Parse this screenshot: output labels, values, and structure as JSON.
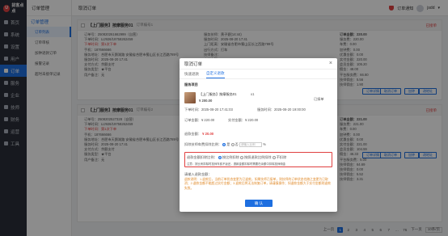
{
  "app": {
    "logo_mark": "U",
    "name": "拢客点点",
    "page_title": "订单管理",
    "breadcrumb": "取消订单",
    "notice_label": "订单通知",
    "user_name": "jsdd",
    "user_caret": "▾"
  },
  "nav": [
    {
      "label": "首页",
      "icon": "home-icon"
    },
    {
      "label": "系统",
      "icon": "system-icon"
    },
    {
      "label": "设置",
      "icon": "settings-icon"
    },
    {
      "label": "用户",
      "icon": "user-icon"
    },
    {
      "label": "订单",
      "icon": "order-icon",
      "active": true
    },
    {
      "label": "服务",
      "icon": "service-icon"
    },
    {
      "label": "企业",
      "icon": "enterprise-icon"
    },
    {
      "label": "技师",
      "icon": "technician-icon"
    },
    {
      "label": "财务",
      "icon": "finance-icon"
    },
    {
      "label": "运营",
      "icon": "operations-icon"
    },
    {
      "label": "工具",
      "icon": "tools-icon"
    }
  ],
  "subnav": {
    "group": "订单管理",
    "items": [
      "订单列表",
      "订单审核",
      "加钟退款订单",
      "报警记录",
      "超时未接单记录"
    ]
  },
  "orders": [
    {
      "shop": "【上门服务】按摩服务01",
      "order_no": "订单编号1",
      "status": "已接单",
      "lines": [
        "订单号：250820261662999（自营）",
        "下单时间：LIJ926/19758262459",
        "下单时间：第1次下单",
        "手机：187666666",
        "服务地址：合肥市天鹅湖路 安徽省合肥市蜀山区长江西路789号",
        "服务时间：2025-08-20 17:41",
        "支付方式：余额支付",
        "服务类型：★平台",
        "用户备注：无"
      ],
      "mid": [
        "服务技师：黄子碧(14:44)",
        "服务时间：2025-08-20 17:41",
        "上门距离：安徽省合肥市蜀山区长江西路789号",
        "出行方式：打车",
        "技师备注：",
        "实付金额："
      ],
      "amounts": [
        "订单金额：220.00",
        "服务费：220.00",
        "车费：0.00",
        "加钟费：0.00",
        "优惠金额：0.00",
        "实付金额：220.00",
        "会员金额：105.20",
        "佣金：48.00",
        "平台服务费：66.80",
        "技师佣金：5.56",
        "技师佣金：1.90"
      ],
      "buttons": [
        "订单详情",
        "取消订单",
        "加钟",
        "改地址"
      ]
    },
    {
      "shop": "【上门服务】按摩服务01",
      "order_no": "订单编号2",
      "status": "已接单",
      "lines": [
        "订单号：25082025273​28（自营）",
        "下单时间：LIJ926/19758262459",
        "下单时间：第1次下单",
        "手机：187666666",
        "服务地址：合肥市天鹅湖路 安徽省合肥市蜀山区长江西路789号",
        "服务时间：2025-08-20 17:41",
        "支付方式：余额支付",
        "服务类型：★平台",
        "用户备注：无"
      ],
      "mid": [
        "服务技师：黄子碧(14:44)",
        "服务时间：2025-08-20 17:41",
        "上门距离：安徽省合肥市蜀山区长江西路789号",
        "出行方式：打车",
        "技师备注：",
        "实付金额："
      ],
      "amounts": [
        "订单金额：221.00",
        "服务费：221.00",
        "车费：0.00",
        "加钟费：0.00",
        "优惠金额：0.00",
        "实付金额：221.00",
        "会员金额：104.59",
        "佣金：46.33",
        "平台服务费：5.00",
        "技师佣金：64.69",
        "技师佣金：0.00",
        "技师佣金：5.52",
        "技师佣金：3.31"
      ],
      "buttons": [
        "订单详情",
        "取消订单",
        "加钟",
        "改地址"
      ]
    }
  ],
  "pager": {
    "prev": "上一页",
    "pages": [
      "1",
      "2",
      "3",
      "4",
      "5",
      "6",
      "7",
      "…",
      "76"
    ],
    "active": "1",
    "next": "下一页",
    "page_size": "10条/页"
  },
  "modal": {
    "title": "取消订单",
    "close": "×",
    "tabs": [
      "快速退款",
      "自定义退款"
    ],
    "active_tab": "自定义退款",
    "section_label": "服务项目",
    "product_name": "【上门服务】按摩服务01",
    "qty": "x1",
    "price": "¥ 200.00",
    "product_status": "已接单",
    "order_time": "下单时间：2025-08-20 17:41:03",
    "service_time": "服务时间：2025-08-20 19:00:00",
    "order_amount": "订单金额：¥ 220.00",
    "paid_amount": "实付金额：¥ 220.00",
    "refund_label": "退款金额：",
    "refund_value": "¥ 20.00",
    "deduct_label": "扣除技师车费扣除比例：",
    "deduct_yes": "是",
    "deduct_no": "否",
    "deduct_placeholder": "请输入比例",
    "deduct_unit": "%",
    "warn_label": "退款金额扣除比例：",
    "warn_option_a": "按比例扣除",
    "warn_option_b": "按照退款比例扣除",
    "warn_option_c": "不扣除",
    "warn_note": "注意：按比例扣除时技师车费不返还，退款金额扣除时需要在余额中扣除技师佣金",
    "cancel_reason_label": "请输入退款金额：",
    "notice": "退款说明：1.退款后，当前订单状态变更为已退款，如果技师已接单，则技师的订单状态也随之变更为已取消；2.退款金额不能超过实付金额；3.退款后将无法恢复订单，请谨慎操作；如退款金额大于实付金额则退款失败。",
    "ok_label": "确 认"
  }
}
